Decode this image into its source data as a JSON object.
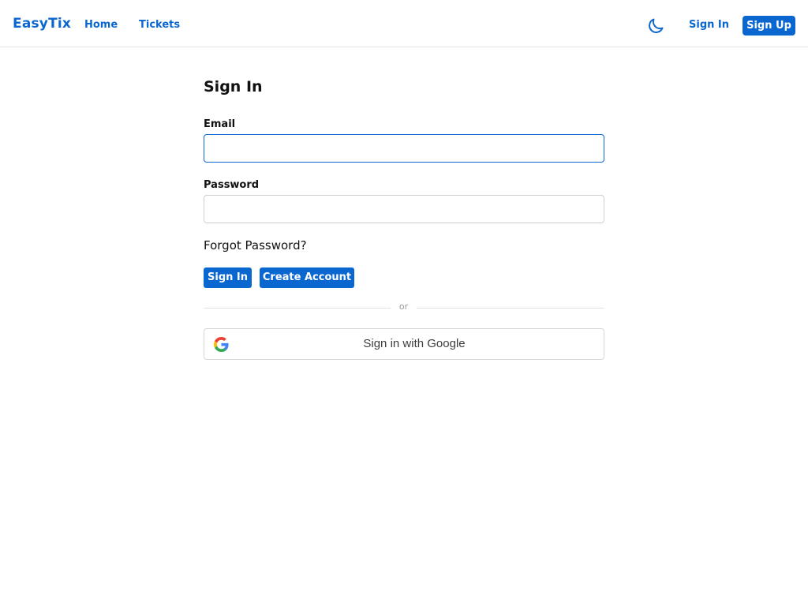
{
  "navbar": {
    "brand": "EasyTix",
    "links": [
      {
        "label": "Home"
      },
      {
        "label": "Tickets"
      }
    ],
    "theme_toggle_icon": "moon-icon",
    "sign_in_label": "Sign In",
    "sign_up_label": "Sign Up"
  },
  "form": {
    "title": "Sign In",
    "email": {
      "label": "Email",
      "value": "",
      "placeholder": ""
    },
    "password": {
      "label": "Password",
      "value": "",
      "placeholder": ""
    },
    "forgot_password_label": "Forgot Password?",
    "sign_in_button_label": "Sign In",
    "create_account_button_label": "Create Account",
    "divider_text": "or",
    "google_button": {
      "label": "Sign in with Google",
      "icon": "google-icon"
    }
  },
  "colors": {
    "accent": "#0b67d0",
    "border": "#cfcfcf",
    "divider": "#e2e2e2",
    "text": "#111111"
  }
}
